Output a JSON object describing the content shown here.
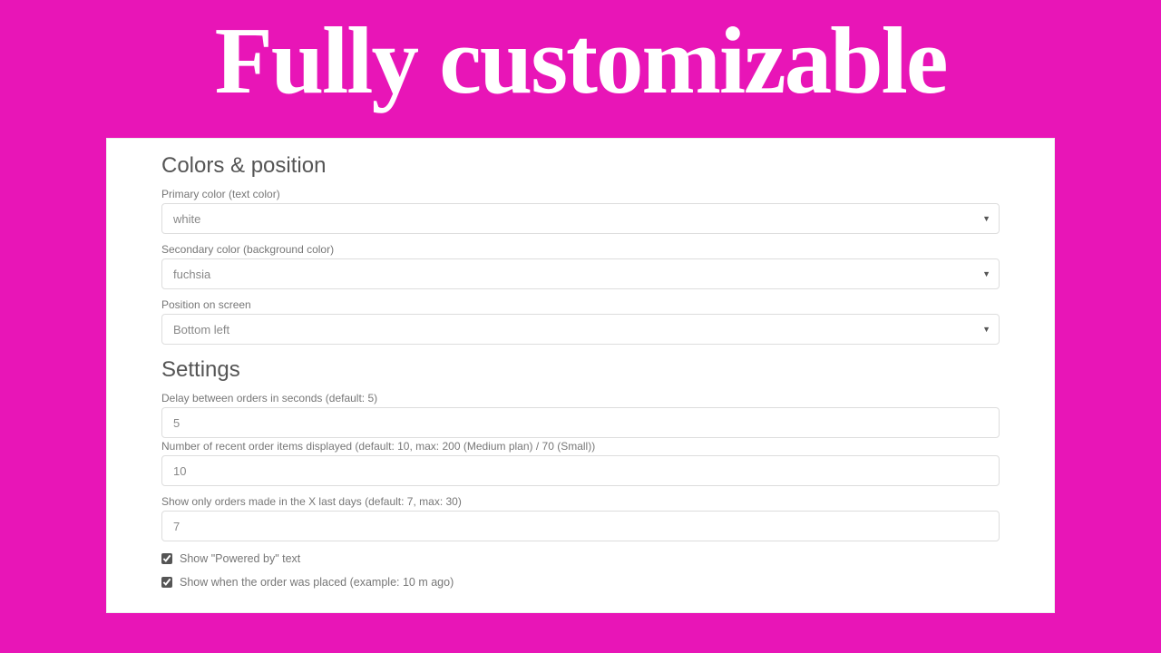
{
  "hero": {
    "title": "Fully customizable"
  },
  "sections": {
    "colors": {
      "heading": "Colors & position",
      "primary_label": "Primary color (text color)",
      "primary_value": "white",
      "secondary_label": "Secondary color (background color)",
      "secondary_value": "fuchsia",
      "position_label": "Position on screen",
      "position_value": "Bottom left"
    },
    "settings": {
      "heading": "Settings",
      "delay_label": "Delay between orders in seconds (default: 5)",
      "delay_value": "5",
      "recent_label": "Number of recent order items displayed (default: 10, max: 200 (Medium plan) / 70 (Small))",
      "recent_value": "10",
      "days_label": "Show only orders made in the X last days (default: 7, max: 30)",
      "days_value": "7",
      "powered_label": "Show \"Powered by\" text",
      "placed_label": "Show when the order was placed (example: 10 m ago)"
    }
  }
}
